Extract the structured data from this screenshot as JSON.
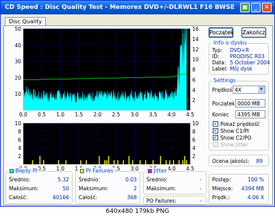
{
  "window": {
    "title": "CD Speed : Disc Quality Test - Memorex DVD+/-DLRWL1 F16 BWSE"
  },
  "tabs": [
    {
      "label": "Disc Quality"
    }
  ],
  "chart_data": [
    {
      "type": "area",
      "title": "",
      "x": [
        0.0,
        0.2,
        0.4,
        0.6,
        0.8,
        1.0,
        1.2,
        1.4,
        1.6,
        1.8,
        2.0,
        2.2,
        2.4,
        2.6,
        2.8,
        3.0,
        3.2,
        3.4,
        3.6,
        3.8,
        3.9,
        4.0,
        4.1,
        4.15,
        4.2,
        4.25,
        4.3,
        4.35,
        4.4
      ],
      "series": [
        {
          "values": [
            12,
            10,
            8,
            9,
            8,
            9,
            8,
            8,
            9,
            8,
            9,
            8,
            9,
            8,
            9,
            9,
            8,
            9,
            8,
            9,
            9,
            10,
            12,
            15,
            22,
            30,
            40,
            46,
            50
          ]
        }
      ],
      "green_line": [
        6.0,
        6.0,
        6.0,
        6.1,
        6.1,
        6.1,
        6.1,
        6.2,
        6.2,
        6.2,
        6.3,
        6.3,
        6.3,
        6.3,
        6.4,
        6.4,
        6.4,
        6.5,
        6.5,
        6.5,
        6.5,
        6.6,
        6.7,
        6.8,
        6.9,
        7.0,
        7.1,
        7.1,
        7.2
      ],
      "xlim": [
        0,
        4.5
      ],
      "ylim_left": [
        0,
        50
      ],
      "ylim_right": [
        0,
        16
      ],
      "xticks": [
        "0.0",
        "0.5",
        "1.0",
        "1.5",
        "2.0",
        "2.5",
        "3.0",
        "3.5",
        "4.0",
        "4.5"
      ],
      "yticks_left": [
        "50",
        "40",
        "30",
        "20",
        "10"
      ],
      "yticks_right": [
        "16",
        "14",
        "12",
        "10",
        "8",
        "6",
        "4",
        "2"
      ]
    },
    {
      "type": "bar",
      "title": "",
      "x": [
        0.25,
        0.45,
        0.55,
        0.95,
        1.15,
        1.55,
        1.7,
        2.05,
        2.2,
        2.25,
        2.3,
        2.45,
        2.55,
        2.7,
        2.85,
        2.95,
        3.15,
        3.3,
        3.5,
        3.7,
        3.85,
        3.95,
        4.05,
        4.2,
        4.3,
        4.35,
        4.4
      ],
      "values": [
        1,
        2,
        1,
        1,
        1,
        1,
        1,
        2,
        1,
        1,
        2,
        1,
        1,
        1,
        2,
        1,
        1,
        1,
        1,
        2,
        1,
        1,
        1,
        1,
        1,
        2,
        1
      ],
      "xlim": [
        0,
        4.5
      ],
      "ylim_left": [
        0,
        10
      ],
      "ylim_right": [
        0,
        10
      ],
      "xticks": [
        "0.0",
        "0.5",
        "1.0",
        "1.5",
        "2.0",
        "2.5",
        "3.0",
        "3.5",
        "4.0",
        "4.5"
      ],
      "yticks_left": [
        "10",
        "8",
        "6",
        "4",
        "2"
      ],
      "yticks_right": [
        "10",
        "8",
        "6",
        "4",
        "2"
      ]
    }
  ],
  "buttons": {
    "start": "Początek",
    "finish": "Zakończ"
  },
  "disc_info": {
    "title": "Info o dysku",
    "rows": [
      {
        "label": "Typ:",
        "value": "DVD+R"
      },
      {
        "label": "ID:",
        "value": "PRODISC R03"
      },
      {
        "label": "Data:",
        "value": "5 October 2004"
      },
      {
        "label": "Label:",
        "value": "Mój dysk"
      }
    ]
  },
  "settings": {
    "title": "Settings",
    "speed_label": "Prędkość",
    "speed_value": "4X",
    "start_label": "Początek",
    "start_value": "0000 MB",
    "end_label": "Koniec",
    "end_value": "4395 MB",
    "checks": [
      {
        "label": "Pokaż prędkość",
        "checked": true,
        "disabled": false
      },
      {
        "label": "Show C1/PI",
        "checked": true,
        "disabled": false
      },
      {
        "label": "Show C2/PO",
        "checked": true,
        "disabled": false
      },
      {
        "label": "Show Jitter",
        "checked": false,
        "disabled": true
      }
    ]
  },
  "quality": {
    "label": "Ocena jakości:",
    "value": "89"
  },
  "pi_errors": {
    "title": "Błędy PI",
    "color": "#00ffff",
    "rows": [
      {
        "label": "Średnio:",
        "value": "5.32"
      },
      {
        "label": "Maksimum:",
        "value": "50"
      },
      {
        "label": "Całość:",
        "value": "60166"
      }
    ]
  },
  "pi_failures": {
    "title": "PI Failures",
    "color": "#ffff00",
    "rows": [
      {
        "label": "Średnio:",
        "value": "0.03"
      },
      {
        "label": "Maksimum:",
        "value": "2"
      },
      {
        "label": "Całość:",
        "value": "368"
      }
    ]
  },
  "jitter": {
    "title": "Jitter",
    "color": "#ff00ff",
    "rows": [
      {
        "label": "Średnio:",
        "value": "-"
      },
      {
        "label": "Maksimum:",
        "value": "-"
      }
    ]
  },
  "po_failures": {
    "label": "PO Failures:",
    "value": "-"
  },
  "progress": {
    "rows": [
      {
        "label": "Postęp:",
        "value": "100 %"
      },
      {
        "label": "Miejsce:",
        "value": "4394 MB"
      },
      {
        "label": "Prędk.:",
        "value": "4.06 X"
      }
    ]
  },
  "caption": "640x480 179kb PNG",
  "colors": {
    "cyan": "#00ffff",
    "green": "#00c000",
    "yellow": "#ffff00",
    "grid": "#0000ff"
  }
}
